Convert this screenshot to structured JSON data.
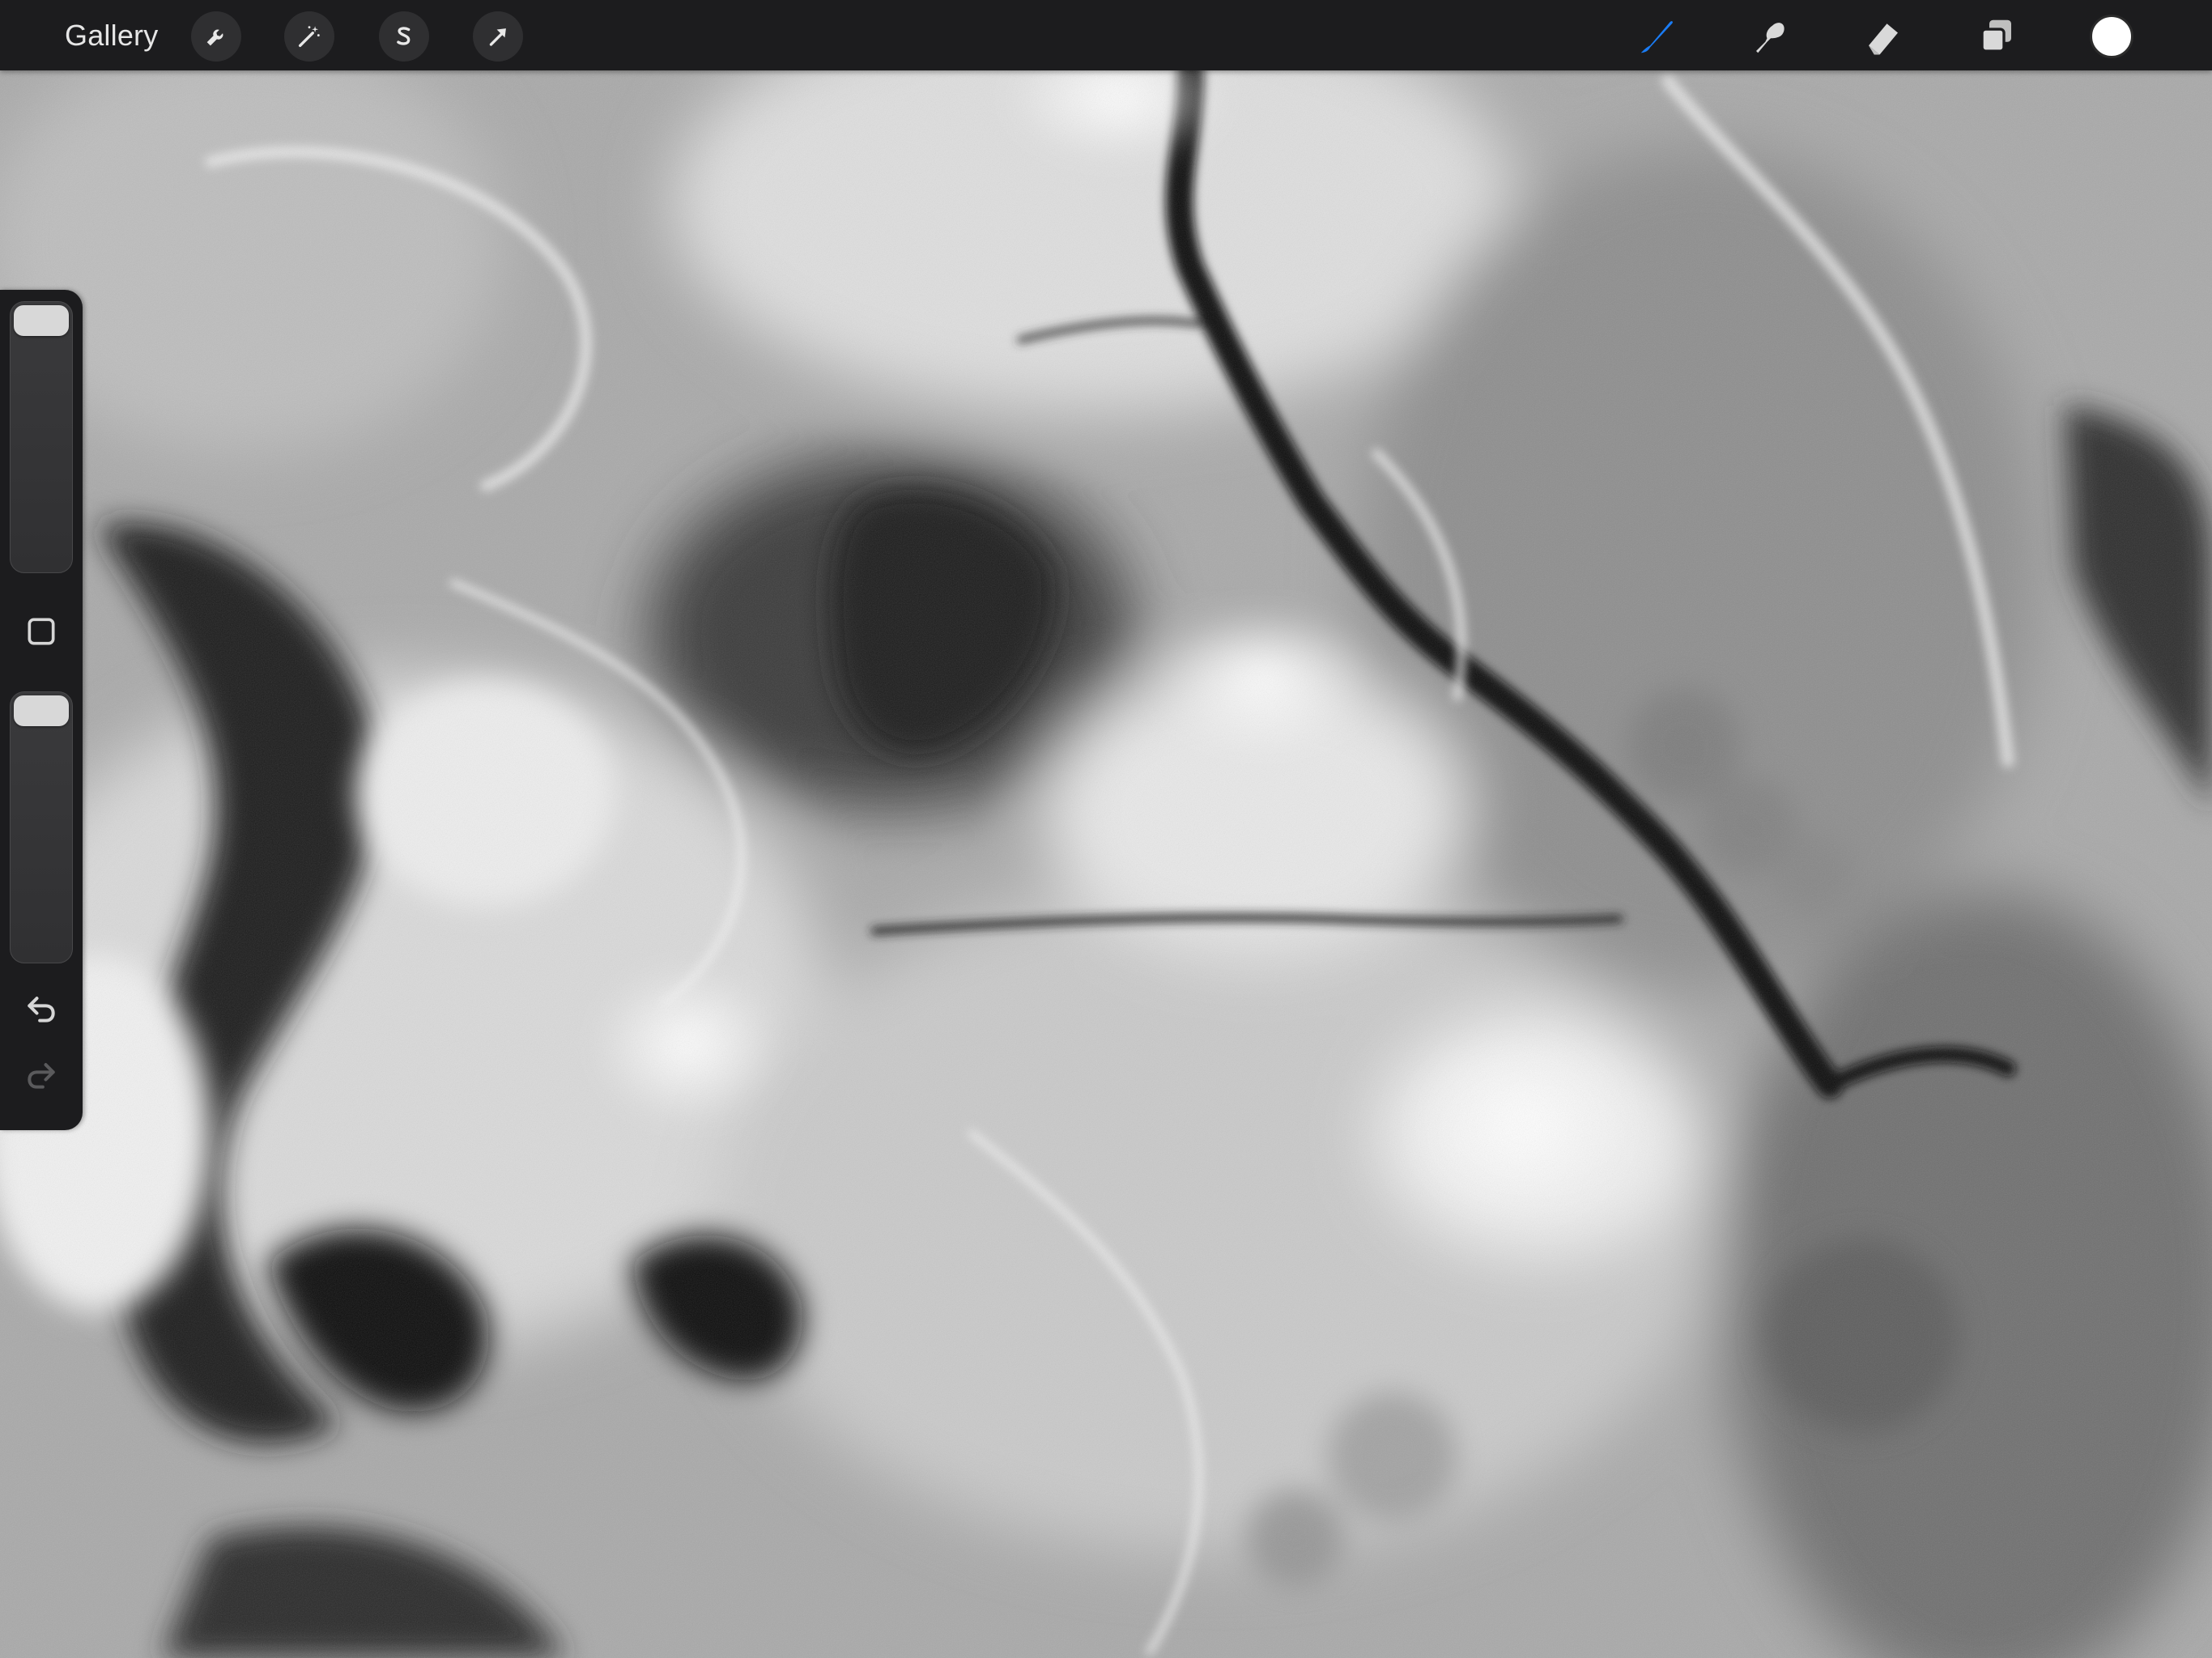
{
  "app": {
    "accent_color": "#1a7cf5",
    "toolbar_bg": "#1c1c1e"
  },
  "toolbar": {
    "gallery_label": "Gallery",
    "left_tools": [
      {
        "name": "actions",
        "icon": "wrench-icon"
      },
      {
        "name": "adjustments",
        "icon": "magic-wand-icon"
      },
      {
        "name": "selection",
        "icon": "selection-s-icon"
      },
      {
        "name": "transform",
        "icon": "transform-arrow-icon"
      }
    ],
    "right_tools": [
      {
        "name": "brush",
        "icon": "brush-icon",
        "active": true
      },
      {
        "name": "smudge",
        "icon": "smudge-icon",
        "active": false
      },
      {
        "name": "eraser",
        "icon": "eraser-icon",
        "active": false
      },
      {
        "name": "layers",
        "icon": "layers-icon",
        "active": false
      }
    ],
    "current_color": "#ffffff"
  },
  "sidebar": {
    "brush_size_level": 1.0,
    "brush_opacity_level": 1.0,
    "modify_icon": "square-modify-icon",
    "undo_icon": "undo-arrow-icon",
    "redo_icon": "redo-arrow-icon",
    "redo_enabled": false
  },
  "canvas": {
    "artwork": "grayscale-painting"
  }
}
